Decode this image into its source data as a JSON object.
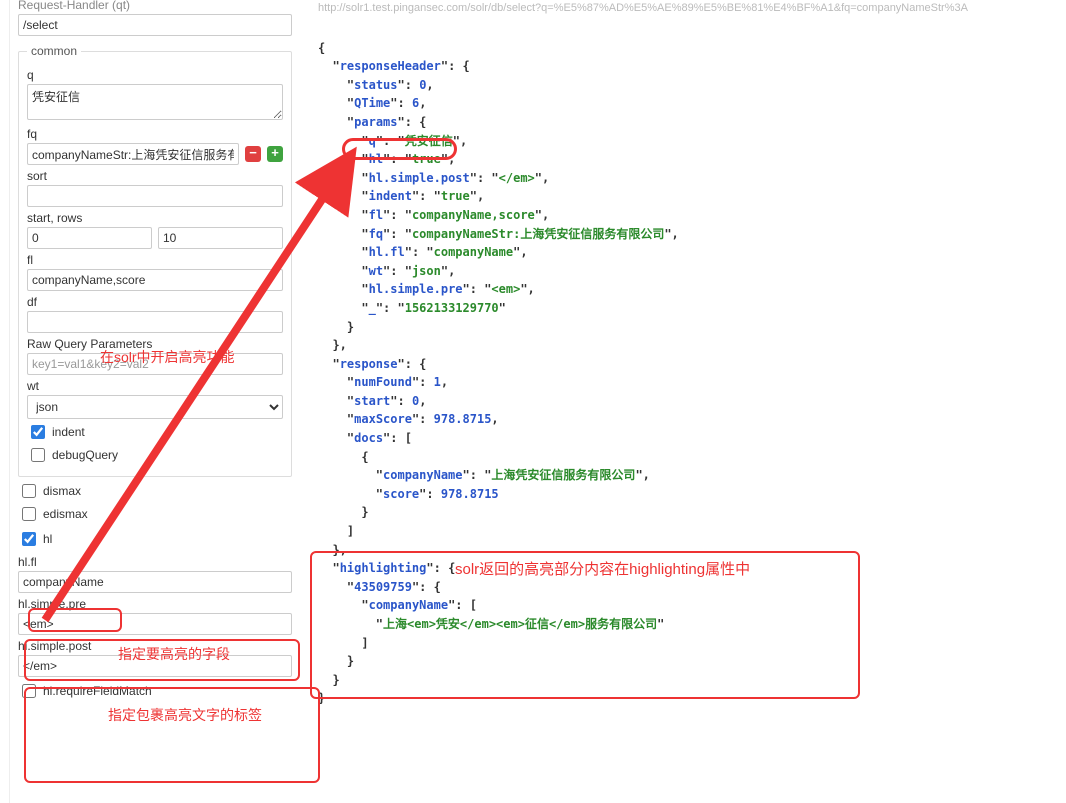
{
  "top_label": "Request-Handler (qt)",
  "qt_value": "/select",
  "common": {
    "legend": "common",
    "q_label": "q",
    "q_value": "凭安征信",
    "fq_label": "fq",
    "fq_value": "companyNameStr:上海凭安征信服务有",
    "sort_label": "sort",
    "sort_value": "",
    "startrows_label": "start, rows",
    "start_value": "0",
    "rows_value": "10",
    "fl_label": "fl",
    "fl_value": "companyName,score",
    "df_label": "df",
    "df_value": "",
    "raw_label": "Raw Query Parameters",
    "raw_placeholder": "key1=val1&key2=val2",
    "wt_label": "wt",
    "wt_value": "json",
    "indent_label": "indent",
    "debugQuery_label": "debugQuery"
  },
  "opts": {
    "dismax": "dismax",
    "edismax": "edismax",
    "hl": "hl",
    "hlfl_label": "hl.fl",
    "hlfl_value": "companyName",
    "hlpre_label": "hl.simple.pre",
    "hlpre_value": "<em>",
    "hlpost_label": "hl.simple.post",
    "hlpost_value": "</em>",
    "require_label": "hl.requireFieldMatch"
  },
  "annotations": {
    "enable_hl": "在solr中开启高亮功能",
    "specify_field": "指定要高亮的字段",
    "wrap_tags": "指定包裹高亮文字的标签",
    "highlighting_note": "solr返回的高亮部分内容在highlighting属性中"
  },
  "url_line": "http://solr1.test.pingansec.com/solr/db/select?q=%E5%87%AD%E5%AE%89%E5%BE%81%E4%BF%A1&fq=companyNameStr%3A",
  "json": {
    "responseHeader": {
      "status": 0,
      "QTime": 6,
      "params": {
        "q": "凭安征信",
        "hl": "true",
        "hl.simple.post": "</em>",
        "indent": "true",
        "fl": "companyName,score",
        "fq": "companyNameStr:上海凭安征信服务有限公司",
        "hl.fl": "companyName",
        "wt": "json",
        "hl.simple.pre": "<em>",
        "_": "1562133129770"
      }
    },
    "response": {
      "numFound": 1,
      "start": 0,
      "maxScore": 978.8715,
      "docs": [
        {
          "companyName": "上海凭安征信服务有限公司",
          "score": 978.8715
        }
      ]
    },
    "highlighting": {
      "43509759": {
        "companyName": [
          "上海<em>凭安</em><em>征信</em>服务有限公司"
        ]
      }
    }
  }
}
